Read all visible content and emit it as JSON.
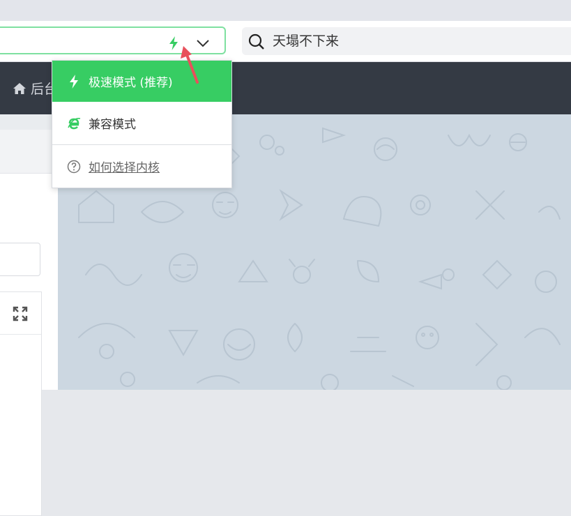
{
  "toolbar": {
    "search_text": "天塌不下来"
  },
  "nav": {
    "home_label": "后台"
  },
  "dropdown": {
    "items": [
      {
        "label": "极速模式 (推荐)",
        "icon": "lightning-icon",
        "active": true
      },
      {
        "label": "兼容模式",
        "icon": "ie-icon",
        "active": false
      },
      {
        "label": "如何选择内核",
        "icon": "question-circle-icon",
        "active": false
      }
    ]
  },
  "colors": {
    "accent_green": "#37cd63",
    "navbar": "#343a44",
    "content_bg": "#ccd7e1",
    "annotation_arrow": "#e8505b"
  }
}
